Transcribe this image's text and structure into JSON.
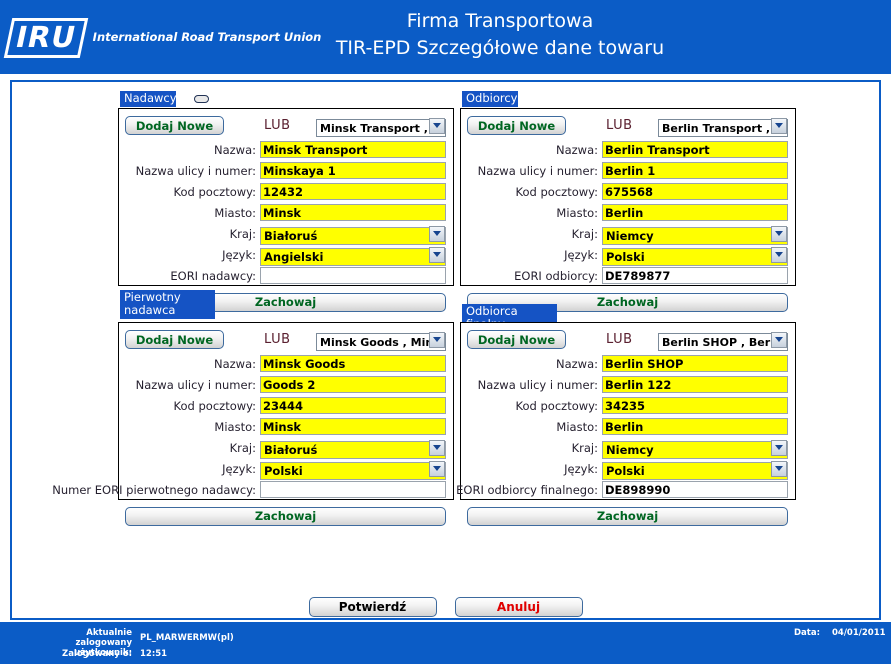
{
  "header": {
    "logo_mark": "IRU",
    "logo_words": "International\nRoad Transport\nUnion",
    "title_line1": "Firma Transportowa",
    "title_line2": "TIR-EPD Szczegółowe dane towaru"
  },
  "common": {
    "add_new_label": "Dodaj Nowe",
    "or_label": "LUB",
    "save_label": "Zachowaj",
    "label_name": "Nazwa:",
    "label_street": "Nazwa ulicy i numer:",
    "label_postcode": "Kod pocztowy:",
    "label_city": "Miasto:",
    "label_country": "Kraj:",
    "label_language": "Język:"
  },
  "panels": [
    {
      "key": "consignors",
      "badge": "Nadawcy",
      "has_badge_icon": true,
      "selector_value": "Minsk Transport , Min",
      "selector_options": [
        "Minsk Transport , Min"
      ],
      "name": "Minsk Transport",
      "street": "Minskaya 1",
      "postcode": "12432",
      "city": "Minsk",
      "country": "Białoruś",
      "country_options": [
        "Białoruś"
      ],
      "language": "Angielski",
      "language_options": [
        "Angielski"
      ],
      "eori_label": "EORI nadawcy:",
      "eori_value": ""
    },
    {
      "key": "consignees",
      "badge": "Odbiorcy",
      "has_badge_icon": false,
      "selector_value": "Berlin Transport , Ber",
      "selector_options": [
        "Berlin Transport , Ber"
      ],
      "name": "Berlin Transport",
      "street": "Berlin 1",
      "postcode": "675568",
      "city": "Berlin",
      "country": "Niemcy",
      "country_options": [
        "Niemcy"
      ],
      "language": "Polski",
      "language_options": [
        "Polski"
      ],
      "eori_label": "EORI odbiorcy:",
      "eori_value": "DE789877"
    },
    {
      "key": "original-consignor",
      "badge": "Pierwotny\nnadawca",
      "has_badge_icon": false,
      "selector_value": "Minsk Goods , Minsk ,",
      "selector_options": [
        "Minsk Goods , Minsk ,"
      ],
      "name": "Minsk Goods",
      "street": "Goods 2",
      "postcode": "23444",
      "city": "Minsk",
      "country": "Białoruś",
      "country_options": [
        "Białoruś"
      ],
      "language": "Polski",
      "language_options": [
        "Polski"
      ],
      "eori_label": "Numer EORI pierwotnego nadawcy:",
      "eori_value": ""
    },
    {
      "key": "final-consignee",
      "badge": "Odbiorca finalny",
      "has_badge_icon": false,
      "selector_value": "Berlin SHOP , Berlin ,",
      "selector_options": [
        "Berlin SHOP , Berlin ,"
      ],
      "name": "Berlin SHOP",
      "street": "Berlin 122",
      "postcode": "34235",
      "city": "Berlin",
      "country": "Niemcy",
      "country_options": [
        "Niemcy"
      ],
      "language": "Polski",
      "language_options": [
        "Polski"
      ],
      "eori_label": "EORI odbiorcy finalnego:",
      "eori_value": "DE898990"
    }
  ],
  "actions": {
    "confirm_label": "Potwierdź",
    "cancel_label": "Anuluj"
  },
  "footer": {
    "user_label": "Aktualnie zalogowany\nużytkownik:",
    "user_value": "PL_MARWERMW(pl)",
    "login_time_label": "Zalogowany o:",
    "login_time_value": "12:51",
    "date_label": "Data:",
    "date_value": "04/01/2011"
  },
  "colors": {
    "brand_blue": "#0B5CC6",
    "badge_blue": "#1553C4",
    "field_highlight": "#FFFF00",
    "save_green": "#006622",
    "cancel_red": "#e00000"
  }
}
